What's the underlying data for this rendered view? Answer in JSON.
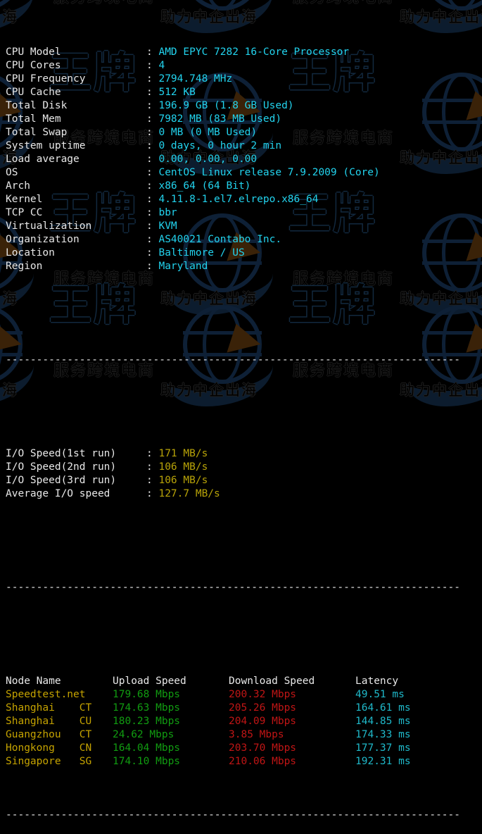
{
  "terminal": {
    "separator": "--------------------------------------------------------------------------",
    "sysinfo": [
      {
        "label": "CPU Model",
        "value": "AMD EPYC 7282 16-Core Processor"
      },
      {
        "label": "CPU Cores",
        "value": "4"
      },
      {
        "label": "CPU Frequency",
        "value": "2794.748 MHz"
      },
      {
        "label": "CPU Cache",
        "value": "512 KB"
      },
      {
        "label": "Total Disk",
        "value": "196.9 GB (1.8 GB Used)"
      },
      {
        "label": "Total Mem",
        "value": "7982 MB (83 MB Used)"
      },
      {
        "label": "Total Swap",
        "value": "0 MB (0 MB Used)"
      },
      {
        "label": "System uptime",
        "value": "0 days, 0 hour 2 min"
      },
      {
        "label": "Load average",
        "value": "0.00, 0.00, 0.00"
      },
      {
        "label": "OS",
        "value": "CentOS Linux release 7.9.2009 (Core)"
      },
      {
        "label": "Arch",
        "value": "x86_64 (64 Bit)"
      },
      {
        "label": "Kernel",
        "value": "4.11.8-1.el7.elrepo.x86_64"
      },
      {
        "label": "TCP CC",
        "value": "bbr"
      },
      {
        "label": "Virtualization",
        "value": "KVM"
      },
      {
        "label": "Organization",
        "value": "AS40021 Contabo Inc."
      },
      {
        "label": "Location",
        "value": "Baltimore / US"
      },
      {
        "label": "Region",
        "value": "Maryland"
      }
    ],
    "iospeed": [
      {
        "label": "I/O Speed(1st run)",
        "value": "171 MB/s"
      },
      {
        "label": "I/O Speed(2nd run)",
        "value": "106 MB/s"
      },
      {
        "label": "I/O Speed(3rd run)",
        "value": "106 MB/s"
      },
      {
        "label": "Average I/O speed",
        "value": "127.7 MB/s"
      }
    ],
    "speedtest": {
      "headers": [
        "Node Name",
        "Upload Speed",
        "Download Speed",
        "Latency"
      ],
      "rows": [
        {
          "node": "Speedtest.net",
          "upload": "179.68 Mbps",
          "download": "200.32 Mbps",
          "latency": "49.51 ms"
        },
        {
          "node": "Shanghai    CT",
          "upload": "174.63 Mbps",
          "download": "205.26 Mbps",
          "latency": "164.61 ms"
        },
        {
          "node": "Shanghai    CU",
          "upload": "180.23 Mbps",
          "download": "204.09 Mbps",
          "latency": "144.85 ms"
        },
        {
          "node": "Guangzhou   CT",
          "upload": "24.62 Mbps",
          "download": "3.85 Mbps",
          "latency": "174.33 ms"
        },
        {
          "node": "Hongkong    CN",
          "upload": "164.04 Mbps",
          "download": "203.70 Mbps",
          "latency": "177.37 ms"
        },
        {
          "node": "Singapore   SG",
          "upload": "174.10 Mbps",
          "download": "210.06 Mbps",
          "latency": "192.31 ms"
        }
      ]
    }
  },
  "watermark": {
    "brand_cjk": "王牌",
    "tagline_cjk": "服务跨境电商",
    "subtag_cjk": "助力中企出海"
  },
  "colors": {
    "background": "#000000",
    "label": "#e8e8e8",
    "value_cyan": "#22d3ee",
    "value_yellow": "#b8a308",
    "node_yellow": "#c5a300",
    "upload_green": "#119c11",
    "download_red": "#c01515",
    "latency_cyan": "#1fb8c9",
    "watermark_navy": "#12293f",
    "watermark_brown": "#3a2208"
  }
}
